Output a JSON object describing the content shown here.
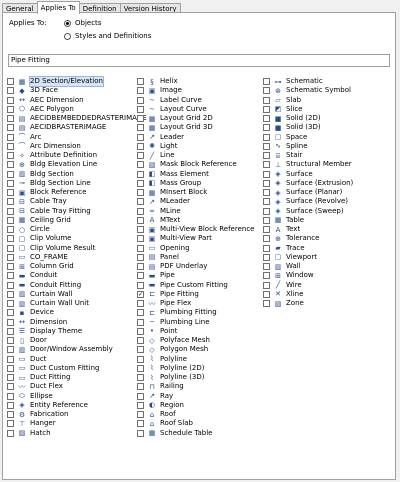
{
  "tabs": [
    {
      "label": "General",
      "active": false
    },
    {
      "label": "Applies To",
      "active": true
    },
    {
      "label": "Definition",
      "active": false
    },
    {
      "label": "Version History",
      "active": false
    }
  ],
  "applies_to": {
    "label": "Applies To:",
    "options": [
      {
        "label": "Objects",
        "selected": true
      },
      {
        "label": "Styles and Definitions",
        "selected": false
      }
    ]
  },
  "selected_summary": "Pipe Fitting",
  "columns": [
    [
      {
        "label": "2D Section/Elevation",
        "icon": "2d-section-elevation-icon",
        "glyph": "▦",
        "checked": false,
        "highlighted": true
      },
      {
        "label": "3D Face",
        "icon": "3d-face-icon",
        "glyph": "◆",
        "checked": false
      },
      {
        "label": "AEC Dimension",
        "icon": "aec-dimension-icon",
        "glyph": "↔",
        "checked": false
      },
      {
        "label": "AEC Polygon",
        "icon": "aec-polygon-icon",
        "glyph": "⬠",
        "checked": false
      },
      {
        "label": "AECIDBEMBEDDEDRASTERIMAGE",
        "icon": "embedded-raster-icon",
        "glyph": "▤",
        "checked": false
      },
      {
        "label": "AECIDBRASTERIMAGE",
        "icon": "raster-image-icon",
        "glyph": "▤",
        "checked": false
      },
      {
        "label": "Arc",
        "icon": "arc-icon",
        "glyph": "⌒",
        "checked": false
      },
      {
        "label": "Arc Dimension",
        "icon": "arc-dimension-icon",
        "glyph": "⌒",
        "checked": false
      },
      {
        "label": "Attribute Definition",
        "icon": "attribute-definition-icon",
        "glyph": "✧",
        "checked": false
      },
      {
        "label": "Bldg Elevation Line",
        "icon": "bldg-elevation-line-icon",
        "glyph": "⊕",
        "checked": false
      },
      {
        "label": "Bldg Section",
        "icon": "bldg-section-icon",
        "glyph": "▥",
        "checked": false
      },
      {
        "label": "Bldg Section Line",
        "icon": "bldg-section-line-icon",
        "glyph": "⊸",
        "checked": false
      },
      {
        "label": "Block Reference",
        "icon": "block-reference-icon",
        "glyph": "▣",
        "checked": false
      },
      {
        "label": "Cable Tray",
        "icon": "cable-tray-icon",
        "glyph": "⊟",
        "checked": false
      },
      {
        "label": "Cable Tray Fitting",
        "icon": "cable-tray-fitting-icon",
        "glyph": "⊟",
        "checked": false
      },
      {
        "label": "Ceiling Grid",
        "icon": "ceiling-grid-icon",
        "glyph": "▦",
        "checked": false
      },
      {
        "label": "Circle",
        "icon": "circle-icon",
        "glyph": "○",
        "checked": false
      },
      {
        "label": "Clip Volume",
        "icon": "clip-volume-icon",
        "glyph": "▢",
        "checked": false
      },
      {
        "label": "Clip Volume Result",
        "icon": "clip-volume-result-icon",
        "glyph": "▢",
        "checked": false
      },
      {
        "label": "CO_FRAME",
        "icon": "co-frame-icon",
        "glyph": "▭",
        "checked": false
      },
      {
        "label": "Column Grid",
        "icon": "column-grid-icon",
        "glyph": "⊞",
        "checked": false
      },
      {
        "label": "Conduit",
        "icon": "conduit-icon",
        "glyph": "▬",
        "checked": false
      },
      {
        "label": "Conduit Fitting",
        "icon": "conduit-fitting-icon",
        "glyph": "▬",
        "checked": false
      },
      {
        "label": "Curtain Wall",
        "icon": "curtain-wall-icon",
        "glyph": "▥",
        "checked": false
      },
      {
        "label": "Curtain Wall Unit",
        "icon": "curtain-wall-unit-icon",
        "glyph": "▥",
        "checked": false
      },
      {
        "label": "Device",
        "icon": "device-icon",
        "glyph": "▪",
        "checked": false
      },
      {
        "label": "Dimension",
        "icon": "dimension-icon",
        "glyph": "↔",
        "checked": false
      },
      {
        "label": "Display Theme",
        "icon": "display-theme-icon",
        "glyph": "☰",
        "checked": false
      },
      {
        "label": "Door",
        "icon": "door-icon",
        "glyph": "▯",
        "checked": false
      },
      {
        "label": "Door/Window Assembly",
        "icon": "door-window-assembly-icon",
        "glyph": "▥",
        "checked": false
      },
      {
        "label": "Duct",
        "icon": "duct-icon",
        "glyph": "▭",
        "checked": false
      },
      {
        "label": "Duct Custom Fitting",
        "icon": "duct-custom-fitting-icon",
        "glyph": "▭",
        "checked": false
      },
      {
        "label": "Duct Fitting",
        "icon": "duct-fitting-icon",
        "glyph": "▭",
        "checked": false
      },
      {
        "label": "Duct Flex",
        "icon": "duct-flex-icon",
        "glyph": "〰",
        "checked": false
      },
      {
        "label": "Ellipse",
        "icon": "ellipse-icon",
        "glyph": "⬭",
        "checked": false
      },
      {
        "label": "Entity Reference",
        "icon": "entity-reference-icon",
        "glyph": "◈",
        "checked": false
      },
      {
        "label": "Fabrication",
        "icon": "fabrication-icon",
        "glyph": "⚙",
        "checked": false
      },
      {
        "label": "Hanger",
        "icon": "hanger-icon",
        "glyph": "⊤",
        "checked": false
      },
      {
        "label": "Hatch",
        "icon": "hatch-icon",
        "glyph": "▨",
        "checked": false
      }
    ],
    [
      {
        "label": "Helix",
        "icon": "helix-icon",
        "glyph": "§",
        "checked": false
      },
      {
        "label": "Image",
        "icon": "image-icon",
        "glyph": "▣",
        "checked": false
      },
      {
        "label": "Label Curve",
        "icon": "label-curve-icon",
        "glyph": "∼",
        "checked": false
      },
      {
        "label": "Layout Curve",
        "icon": "layout-curve-icon",
        "glyph": "∼",
        "checked": false
      },
      {
        "label": "Layout Grid 2D",
        "icon": "layout-grid-2d-icon",
        "glyph": "▦",
        "checked": false
      },
      {
        "label": "Layout Grid 3D",
        "icon": "layout-grid-3d-icon",
        "glyph": "▦",
        "checked": false
      },
      {
        "label": "Leader",
        "icon": "leader-icon",
        "glyph": "↗",
        "checked": false
      },
      {
        "label": "Light",
        "icon": "light-icon",
        "glyph": "✺",
        "checked": false
      },
      {
        "label": "Line",
        "icon": "line-icon",
        "glyph": "╱",
        "checked": false
      },
      {
        "label": "Mask Block Reference",
        "icon": "mask-block-reference-icon",
        "glyph": "▧",
        "checked": false
      },
      {
        "label": "Mass Element",
        "icon": "mass-element-icon",
        "glyph": "◧",
        "checked": false
      },
      {
        "label": "Mass Group",
        "icon": "mass-group-icon",
        "glyph": "◧",
        "checked": false
      },
      {
        "label": "MInsert Block",
        "icon": "minsert-block-icon",
        "glyph": "▦",
        "checked": false
      },
      {
        "label": "MLeader",
        "icon": "mleader-icon",
        "glyph": "↗",
        "checked": false
      },
      {
        "label": "MLine",
        "icon": "mline-icon",
        "glyph": "═",
        "checked": false
      },
      {
        "label": "MText",
        "icon": "mtext-icon",
        "glyph": "A",
        "checked": false
      },
      {
        "label": "Multi-View Block Reference",
        "icon": "multi-view-block-reference-icon",
        "glyph": "▣",
        "checked": false
      },
      {
        "label": "Multi-View Part",
        "icon": "multi-view-part-icon",
        "glyph": "▣",
        "checked": false
      },
      {
        "label": "Opening",
        "icon": "opening-icon",
        "glyph": "▭",
        "checked": false
      },
      {
        "label": "Panel",
        "icon": "panel-icon",
        "glyph": "▤",
        "checked": false
      },
      {
        "label": "PDF Underlay",
        "icon": "pdf-underlay-icon",
        "glyph": "▤",
        "checked": false
      },
      {
        "label": "Pipe",
        "icon": "pipe-icon",
        "glyph": "▬",
        "checked": false
      },
      {
        "label": "Pipe Custom Fitting",
        "icon": "pipe-custom-fitting-icon",
        "glyph": "▬",
        "checked": false
      },
      {
        "label": "Pipe Fitting",
        "icon": "pipe-fitting-icon",
        "glyph": "⊏",
        "checked": true
      },
      {
        "label": "Pipe Flex",
        "icon": "pipe-flex-icon",
        "glyph": "〰",
        "checked": false
      },
      {
        "label": "Plumbing Fitting",
        "icon": "plumbing-fitting-icon",
        "glyph": "⊏",
        "checked": false
      },
      {
        "label": "Plumbing Line",
        "icon": "plumbing-line-icon",
        "glyph": "─",
        "checked": false
      },
      {
        "label": "Point",
        "icon": "point-icon",
        "glyph": "•",
        "checked": false
      },
      {
        "label": "Polyface Mesh",
        "icon": "polyface-mesh-icon",
        "glyph": "◇",
        "checked": false
      },
      {
        "label": "Polygon Mesh",
        "icon": "polygon-mesh-icon",
        "glyph": "◇",
        "checked": false
      },
      {
        "label": "Polyline",
        "icon": "polyline-icon",
        "glyph": "⌇",
        "checked": false
      },
      {
        "label": "Polyline (2D)",
        "icon": "polyline-2d-icon",
        "glyph": "⌇",
        "checked": false
      },
      {
        "label": "Polyline (3D)",
        "icon": "polyline-3d-icon",
        "glyph": "⌇",
        "checked": false
      },
      {
        "label": "Railing",
        "icon": "railing-icon",
        "glyph": "⊓",
        "checked": false
      },
      {
        "label": "Ray",
        "icon": "ray-icon",
        "glyph": "↗",
        "checked": false
      },
      {
        "label": "Region",
        "icon": "region-icon",
        "glyph": "◐",
        "checked": false
      },
      {
        "label": "Roof",
        "icon": "roof-icon",
        "glyph": "⌂",
        "checked": false
      },
      {
        "label": "Roof Slab",
        "icon": "roof-slab-icon",
        "glyph": "⌂",
        "checked": false
      },
      {
        "label": "Schedule Table",
        "icon": "schedule-table-icon",
        "glyph": "▦",
        "checked": false
      }
    ],
    [
      {
        "label": "Schematic",
        "icon": "schematic-icon",
        "glyph": "⊶",
        "checked": false
      },
      {
        "label": "Schematic Symbol",
        "icon": "schematic-symbol-icon",
        "glyph": "⊛",
        "checked": false
      },
      {
        "label": "Slab",
        "icon": "slab-icon",
        "glyph": "▱",
        "checked": false
      },
      {
        "label": "Slice",
        "icon": "slice-icon",
        "glyph": "◩",
        "checked": false
      },
      {
        "label": "Solid (2D)",
        "icon": "solid-2d-icon",
        "glyph": "■",
        "checked": false
      },
      {
        "label": "Solid (3D)",
        "icon": "solid-3d-icon",
        "glyph": "■",
        "checked": false
      },
      {
        "label": "Space",
        "icon": "space-icon",
        "glyph": "▢",
        "checked": false
      },
      {
        "label": "Spline",
        "icon": "spline-icon",
        "glyph": "∿",
        "checked": false
      },
      {
        "label": "Stair",
        "icon": "stair-icon",
        "glyph": "⌸",
        "checked": false
      },
      {
        "label": "Structural Member",
        "icon": "structural-member-icon",
        "glyph": "⊥",
        "checked": false
      },
      {
        "label": "Surface",
        "icon": "surface-icon",
        "glyph": "◈",
        "checked": false
      },
      {
        "label": "Surface (Extrusion)",
        "icon": "surface-extrusion-icon",
        "glyph": "◈",
        "checked": false
      },
      {
        "label": "Surface (Planar)",
        "icon": "surface-planar-icon",
        "glyph": "◈",
        "checked": false
      },
      {
        "label": "Surface (Revolve)",
        "icon": "surface-revolve-icon",
        "glyph": "◈",
        "checked": false
      },
      {
        "label": "Surface (Sweep)",
        "icon": "surface-sweep-icon",
        "glyph": "◈",
        "checked": false
      },
      {
        "label": "Table",
        "icon": "table-icon",
        "glyph": "▦",
        "checked": false
      },
      {
        "label": "Text",
        "icon": "text-icon",
        "glyph": "A",
        "checked": false
      },
      {
        "label": "Tolerance",
        "icon": "tolerance-icon",
        "glyph": "⊕",
        "checked": false
      },
      {
        "label": "Trace",
        "icon": "trace-icon",
        "glyph": "▰",
        "checked": false
      },
      {
        "label": "Viewport",
        "icon": "viewport-icon",
        "glyph": "▢",
        "checked": false
      },
      {
        "label": "Wall",
        "icon": "wall-icon",
        "glyph": "▥",
        "checked": false
      },
      {
        "label": "Window",
        "icon": "window-icon",
        "glyph": "⊞",
        "checked": false
      },
      {
        "label": "Wire",
        "icon": "wire-icon",
        "glyph": "╱",
        "checked": false
      },
      {
        "label": "Xline",
        "icon": "xline-icon",
        "glyph": "✕",
        "checked": false
      },
      {
        "label": "Zone",
        "icon": "zone-icon",
        "glyph": "▧",
        "checked": false
      }
    ]
  ]
}
